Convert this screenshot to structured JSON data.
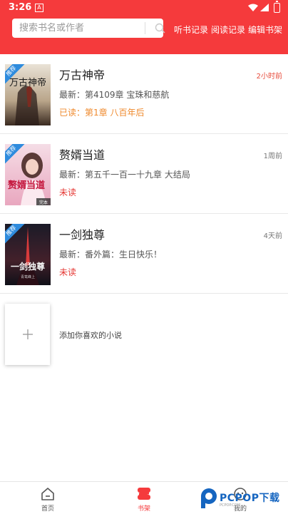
{
  "status_bar": {
    "time": "3:26",
    "notification_glyph": "A"
  },
  "search": {
    "placeholder": "搜索书名或作者"
  },
  "header": {
    "links": [
      "听书记录",
      "阅读记录",
      "编辑书架"
    ]
  },
  "books": [
    {
      "title": "万古神帝",
      "time": "2小时前",
      "latest": "最新：第4109章 宝珠和慈航",
      "read_status": "已读：第1章 八百年后",
      "tag": "推荐",
      "read_color": "#ef8a2e",
      "time_color": "#e74c3c",
      "cover_text": "万古神帝"
    },
    {
      "title": "赘婿当道",
      "time": "1周前",
      "latest": "最新：第五千一百一十九章 大结局",
      "read_status": "未读",
      "tag": "推荐",
      "read_color": "#e53935",
      "time_color": "#777777",
      "cover_text": "赘婿当道",
      "cover_badge": "完本"
    },
    {
      "title": "一剑独尊",
      "time": "4天前",
      "latest": "最新：番外篇：生日快乐！",
      "read_status": "未读",
      "tag": "推荐",
      "read_color": "#e53935",
      "time_color": "#777777",
      "cover_text": "一剑独尊",
      "cover_author": "青鸾峰上"
    }
  ],
  "add_book": {
    "label": "添加你喜欢的小说"
  },
  "tabs": [
    {
      "label": "首页",
      "icon": "home-icon",
      "active": false
    },
    {
      "label": "书架",
      "icon": "bookshelf-icon",
      "active": true
    },
    {
      "label": "我的",
      "icon": "profile-icon",
      "active": false
    }
  ],
  "watermark": {
    "text": "PCPOP下载",
    "sub": "PCPOP.COM"
  },
  "colors": {
    "brand_red": "#f53a3c",
    "tag_blue": "#2e8bdd"
  }
}
